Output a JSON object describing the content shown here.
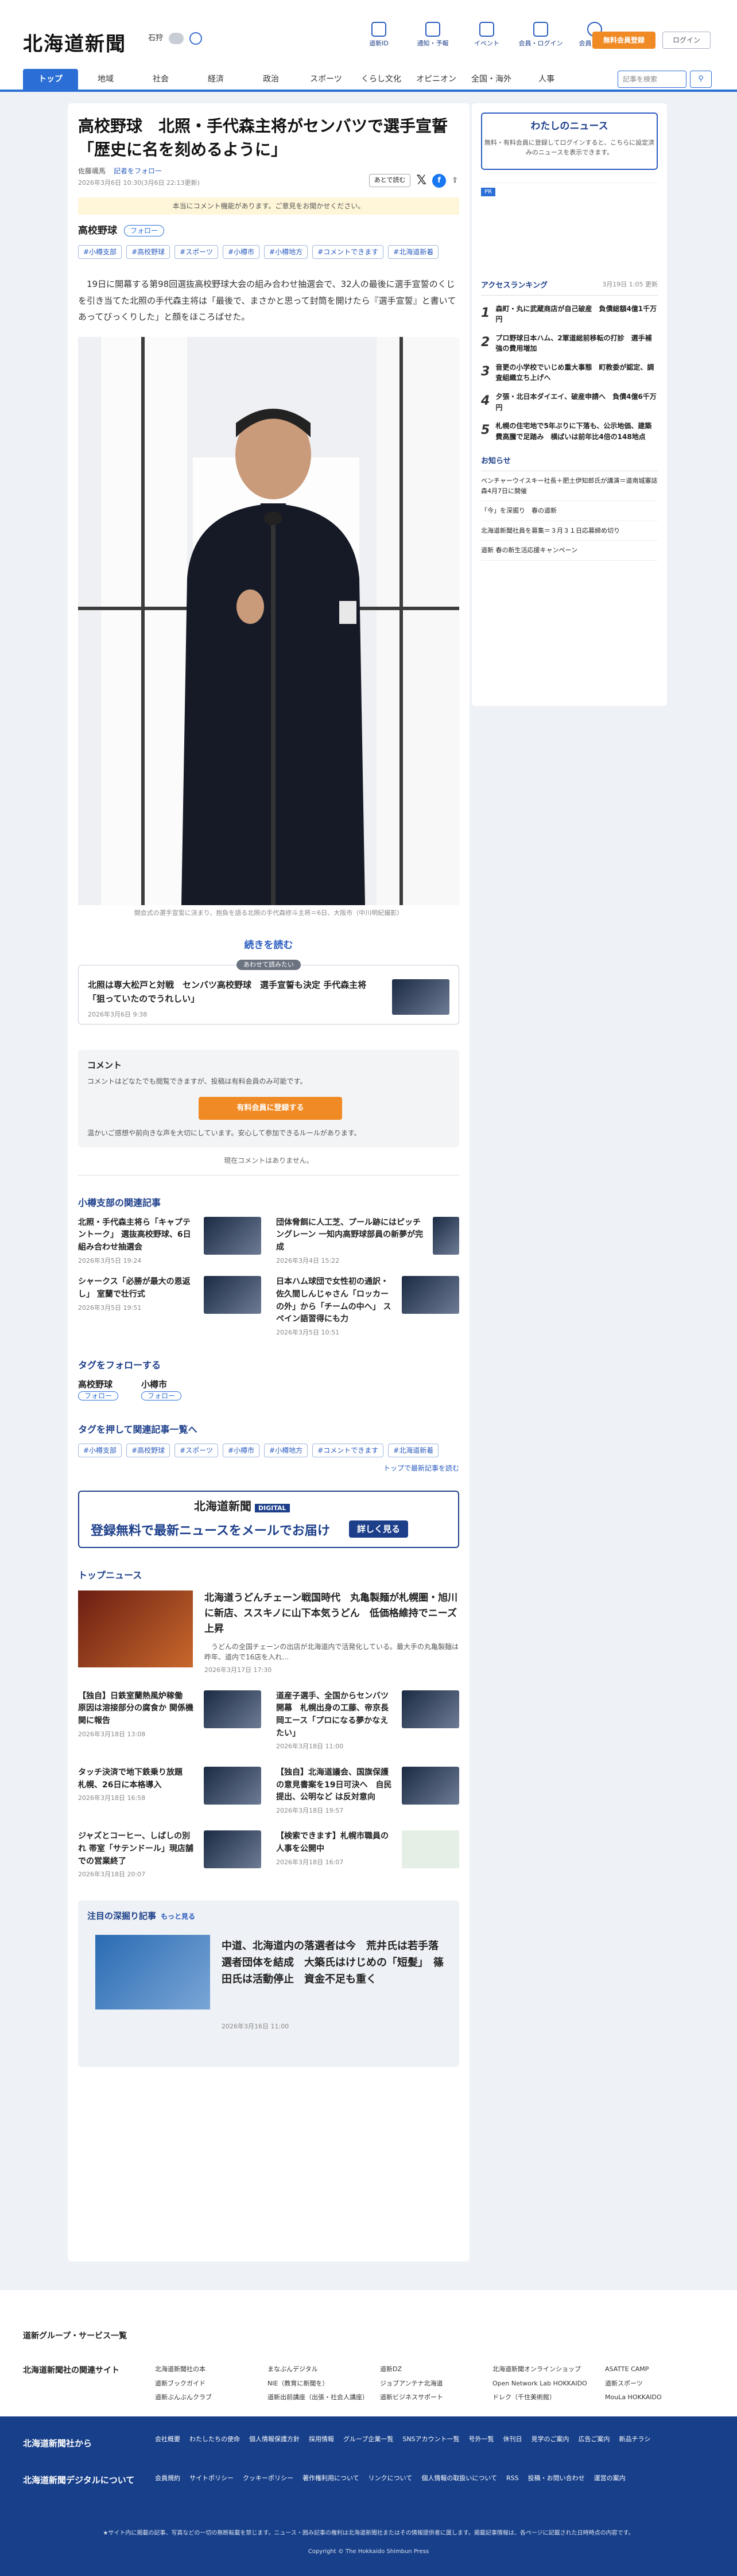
{
  "header": {
    "logo": "北海道新聞",
    "city": "石狩",
    "nav": [
      "道新ID",
      "通知・予報",
      "イベント",
      "会員・ログイン",
      "会員ガイド"
    ],
    "register": "無料会員登録",
    "login": "ログイン"
  },
  "gnav": [
    "トップ",
    "地域",
    "社会",
    "経済",
    "政治",
    "スポーツ",
    "くらし文化",
    "オピニオン",
    "全国・海外",
    "人事"
  ],
  "search": {
    "placeholder": "記事を検索"
  },
  "article": {
    "title": "高校野球　北照・手代森主将がセンバツで選手宣誓「歴史に名を刻めるように」",
    "author": "佐藤颯馬",
    "follow_author": "記者をフォロー",
    "date": "2026年3月6日 10:30(3月6日 22:13更新)",
    "share_label": "あとで読む",
    "notice": "本当にコメント機能があります。ご意見をお聞かせください。",
    "tag_head": "高校野球",
    "follow": "フォロー",
    "tags": [
      "#小樽支部",
      "#高校野球",
      "#スポーツ",
      "#小樽市",
      "#小樽地方",
      "#コメントできます",
      "#北海道新着"
    ],
    "body": "　19日に開幕する第98回選抜高校野球大会の組み合わせ抽選会で、32人の最後に選手宣誓のくじを引き当てた北照の手代森主将は「最後で、まさかと思って封筒を開けたら『選手宣誓』と書いてあってびっくりした」と顔をほころばせた。",
    "caption": "開会式の選手宣誓に決まり、抱負を語る北照の手代森修斗主将＝6日、大阪市（中川明紀撮影）",
    "read_more": "続きを読む"
  },
  "recommend": {
    "badge": "あわせて読みたい",
    "title": "北照は専大松戸と対戦　センバツ高校野球　選手宣誓も決定 手代森主将「狙っていたのでうれしい」",
    "date": "2026年3月6日 9:38"
  },
  "comment": {
    "title": "コメント",
    "note": "コメントはどなたでも閲覧できますが、投稿は有料会員のみ可能です。",
    "button": "有料会員に登録する",
    "guide": "温かいご感想や前向きな声を大切にしています。安心して参加できるルールがあります。",
    "none": "現在コメントはありません。"
  },
  "related": {
    "heading": "小樽支部の関連記事",
    "items": [
      {
        "title": "北照・手代森主将ら「キャプテントーク」 選抜高校野球、6日組み合わせ抽選会",
        "date": "2026年3月5日 19:24"
      },
      {
        "title": "団体脅餌に人工芝、プール跡にはピッチングレーン 一知内高野球部員の新夢が完成",
        "date": "2026年3月4日 15:22"
      },
      {
        "title": "シャークス「必勝が最大の恩返し」 室蘭で壮行式",
        "date": "2026年3月5日 19:51"
      },
      {
        "title": "日本ハム球団で女性初の通訳・佐久間しんじゃさん「ロッカーの外」から「チームの中へ」 スペイン語習得にも力",
        "date": "2026年3月5日 10:51"
      }
    ]
  },
  "tag_follow": {
    "heading": "タグをフォローする",
    "tags": [
      "高校野球",
      "小樽市"
    ],
    "follow": "フォロー"
  },
  "tag_list": {
    "heading": "タグを押して関連記事一覧へ",
    "to_top": "トップで最新記事を読む"
  },
  "newsletter": {
    "logo": "北海道新聞",
    "logo_badge": "DIGITAL",
    "title": "登録無料で最新ニュースをメールでお届け",
    "button": "詳しく見る"
  },
  "topnews": {
    "heading": "トップニュース",
    "lead": {
      "title": "北海道うどんチェーン戦国時代　丸亀製麺が札幌圏・旭川に新店、ススキノに山下本気うどん　低価格維持でニーズ上昇",
      "summary": "　うどんの全国チェーンの出店が北海道内で活発化している。最大手の丸亀製麺は昨年、道内で16店を入れ…",
      "date": "2026年3月17日 17:30"
    },
    "items": [
      {
        "title": "【独自】日鉄室蘭熱風炉稼働　原因は溶接部分の腐食か 関係機関に報告",
        "date": "2026年3月18日 13:08"
      },
      {
        "title": "道産子選手、全国からセンバツ開幕　札幌出身の工藤、帝京長岡エース「プロになる夢かなえたい」",
        "date": "2026年3月18日 11:00"
      },
      {
        "title": "タッチ決済で地下鉄乗り放題　札幌、26日に本格導入",
        "date": "2026年3月18日 16:58"
      },
      {
        "title": "【独自】北海道議会、国旗保護の意見書案を19日可決へ　自民提出、公明など は反対意向",
        "date": "2026年3月18日 19:57"
      },
      {
        "title": "ジャズとコーヒー、しばしの別れ 帯室「サテンドール」現店舗での営業終了",
        "date": "2026年3月18日 20:07"
      },
      {
        "title": "【検索できます】札幌市職員の人事を公開中",
        "date": "2026年3月18日 16:07"
      }
    ]
  },
  "deep": {
    "heading": "注目の深掘り記事",
    "more": "もっと見る",
    "title": "中道、北海道内の落選者は今　荒井氏は若手落選者団体を結成　大築氏はけじめの「短髪」　篠田氏は活動停止　資金不足も重く",
    "date": "2026年3月16日 11:00"
  },
  "side": {
    "my": {
      "title": "わたしのニュース",
      "text": "無料・有料会員に登録してログインすると、こちらに設定済みのニュースを表示できます。"
    },
    "ad": "PR",
    "rank_title": "アクセスランキング",
    "rank_date": "3月19日 1:05 更新",
    "rank": [
      "森町・丸に武蔵商店が自己破産　負債総額4億1千万円",
      "プロ野球日本ハム、2軍道総前移転の打診　選手補強の費用増加",
      "音更の小学校でいじめ重大事態　町教委が認定、調査組織立ち上げへ",
      "夕張・北日本ダイエイ、破産申請へ　負債4億6千万円",
      "札幌の住宅地で5年ぶりに下落も、公示地価、建築費高騰で足踏み　横ばいは前年比4倍の148地点"
    ],
    "oshirase_title": "お知らせ",
    "oshirase": [
      "ベンチャーウイスキー社長＋肥土伊知郎氏が講演＝道南城塞誌森4月7日に開催",
      "「今」を深掘り　春の道新",
      "北海道新聞社員を募集＝３月３１日応募締め切り",
      "道新 春の新生活応援キャンペーン"
    ]
  },
  "footer": {
    "group": "道新グループ・サービス一覧",
    "related_title": "北海道新聞社の関連サイト",
    "related": [
      "北海道新聞社の本",
      "まなぶんデジタル",
      "道新DZ",
      "北海道新聞オンラインショップ",
      "ASATTE CAMP",
      "道新ブックガイド",
      "NIE（教育に新聞を）",
      "ジョブアンテナ北海道",
      "Open Network Lab HOKKAIDO",
      "道新スポーツ",
      "道新ぶんぶんクラブ",
      "道新出前講座（出張・社会人講座）",
      "道新ビジネスサポート",
      "ドレク（千住美術館）",
      "MouLa HOKKAIDO"
    ],
    "co_title": "北海道新聞社から",
    "co": [
      "会社概要",
      "わたしたちの使命",
      "個人情報保護方針",
      "採用情報",
      "グループ企業一覧",
      "SNSアカウント一覧",
      "号外一覧",
      "休刊日",
      "見学のご案内",
      "広告ご案内",
      "新品チラシ"
    ],
    "dg_title": "北海道新聞デジタルについて",
    "dg": [
      "会員規約",
      "サイトポリシー",
      "クッキーポリシー",
      "著作権利用について",
      "リンクについて",
      "個人情報の取扱いについて",
      "RSS",
      "投稿・お問い合わせ",
      "運営の案内"
    ],
    "notice": "★サイト内に掲載の記事、写真などの一切の無断転載を禁じます。ニュース・囲み記事の権利は北海道新聞社またはその情報提供者に属します。掲載記事情報は、各ページに記載された日時時点の内容です。",
    "copy": "Copyright © The Hokkaido Shimbun Press"
  }
}
